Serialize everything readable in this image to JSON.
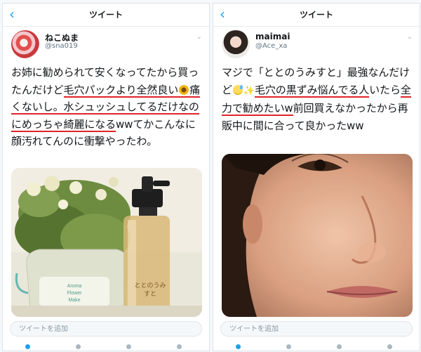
{
  "left": {
    "nav_title": "ツイート",
    "name": "ねこぬま",
    "handle": "@sna019",
    "tweet_parts": [
      "お姉に勧められて安くなってたから買ったんだけど",
      "毛穴パックより全然良い",
      "痛くないし。",
      "水シュッシュしてるだけなのにめっちゃ綺麗になる",
      "wwてかこんなに顔汚れてんのに衝撃やったわ。"
    ],
    "product_name": "ととのうみすと",
    "bag_text": "Aroma Flower Make",
    "compose_placeholder": "ツイートを追加"
  },
  "right": {
    "nav_title": "ツイート",
    "name": "maimai",
    "handle": "@Ace_xa",
    "tweet_parts": [
      "マジで「ととのうみすと」最強なんだけど",
      "毛穴の黒ずみ悩んでる人",
      "いたら",
      "全力で勧めたいw",
      "前回買えなかったから再販中に間に合って良かったww"
    ],
    "compose_placeholder": "ツイートを追加"
  },
  "colors": {
    "accent": "#1da1f2",
    "underline": "#e0242a"
  },
  "icons": {
    "back": "chevron-left-icon",
    "more": "chevron-down-icon",
    "emoji_left": "sunflower-emoji",
    "emoji_right": "sweat-smile-emoji",
    "sparkle": "sparkles-emoji"
  }
}
